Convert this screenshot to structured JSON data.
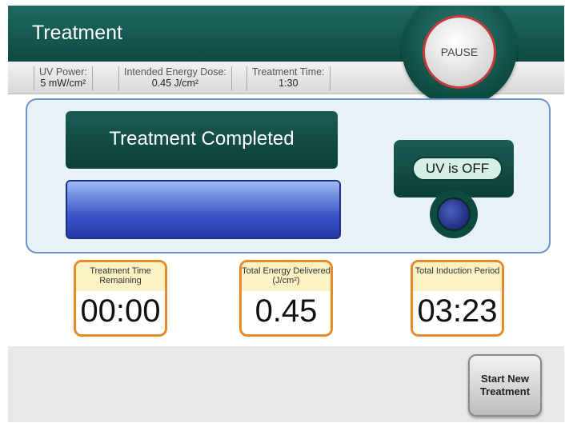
{
  "header": {
    "title": "Treatment"
  },
  "info": [
    {
      "label": "UV Power:",
      "value": "5 mW/cm²"
    },
    {
      "label": "Intended Energy Dose:",
      "value": "0.45 J/cm²"
    },
    {
      "label": "Treatment Time:",
      "value": "1:30"
    }
  ],
  "pause_label": "PAUSE",
  "status": {
    "message": "Treatment Completed",
    "progress_fraction": 1.0
  },
  "uv": {
    "state_label": "UV is OFF"
  },
  "stats": [
    {
      "label": "Treatment Time Remaining",
      "value": "00:00"
    },
    {
      "label": "Total Energy Delivered (J/cm²)",
      "value": "0.45"
    },
    {
      "label": "Total Induction Period",
      "value": "03:23"
    }
  ],
  "footer": {
    "new_treatment_label": "Start New Treatment"
  },
  "colors": {
    "header": "#0e4a42",
    "accent_orange": "#e8892a",
    "progress_blue": "#2c45b8",
    "pause_ring": "#c83a3a"
  }
}
